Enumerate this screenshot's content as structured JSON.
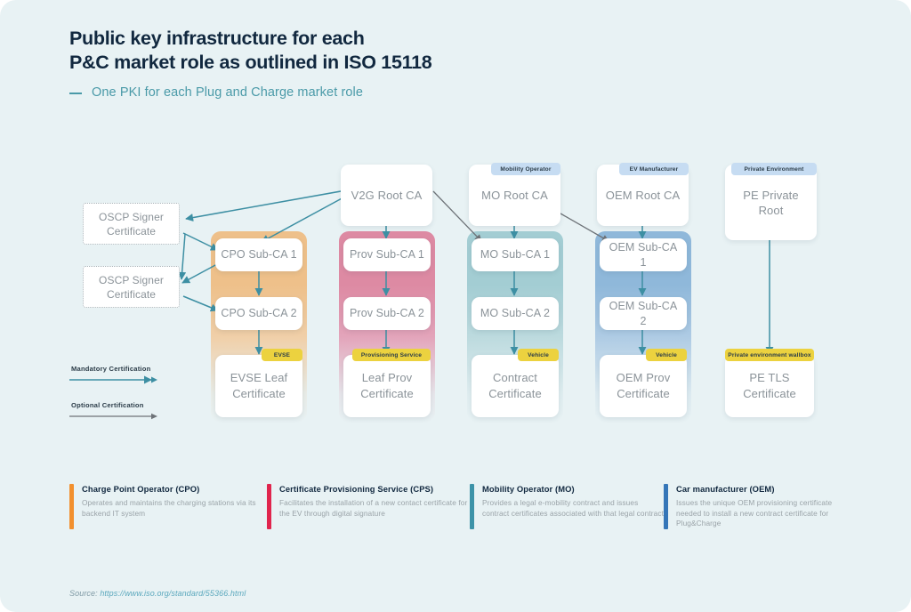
{
  "header": {
    "title_line1": "Public key infrastructure for each",
    "title_line2": "P&C market role as outlined in ISO 15118",
    "subtitle": "One PKI for each Plug and Charge market role"
  },
  "diagram": {
    "roots": [
      {
        "id": "v2g",
        "label": "V2G Root CA",
        "tag": null
      },
      {
        "id": "mo",
        "label": "MO Root CA",
        "tag": "Mobility Operator"
      },
      {
        "id": "oem",
        "label": "OEM Root CA",
        "tag": "EV Manufacturer"
      },
      {
        "id": "pe",
        "label": "PE Private\nRoot",
        "tag": "Private Environment"
      }
    ],
    "root_labels": {
      "v2g": "V2G Root CA",
      "mo": "MO Root CA",
      "oem": "OEM Root CA",
      "pe": "PE Private Root"
    },
    "root_tags": {
      "mo": "Mobility Operator",
      "oem": "EV Manufacturer",
      "pe": "Private Environment"
    },
    "ocsp": {
      "first": "OSCP Signer Certificate",
      "second": "OSCP Signer Certificate"
    },
    "columns": [
      {
        "id": "cpo",
        "color": "#eec08a",
        "sub1": "CPO Sub-CA 1",
        "sub2": "CPO Sub-CA 2",
        "leaf": "EVSE Leaf Certificate",
        "leaf_tag": "EVSE"
      },
      {
        "id": "prov",
        "color": "#dd8aa3",
        "sub1": "Prov Sub-CA 1",
        "sub2": "Prov Sub-CA 2",
        "leaf": "Leaf Prov Certificate",
        "leaf_tag": "Provisioning Service"
      },
      {
        "id": "mo",
        "color": "#a3cdd3",
        "sub1": "MO Sub-CA 1",
        "sub2": "MO Sub-CA 2",
        "leaf": "Contract Certificate",
        "leaf_tag": "Vehicle"
      },
      {
        "id": "oem",
        "color": "#8fb8da",
        "sub1": "OEM Sub-CA 1",
        "sub2": "OEM Sub-CA 2",
        "leaf": "OEM Prov Certificate",
        "leaf_tag": "Vehicle"
      },
      {
        "id": "pe",
        "color": "none",
        "sub1": null,
        "sub2": null,
        "leaf": "PE TLS Certificate",
        "leaf_tag": "Private environment wallbox"
      }
    ],
    "arrow_legend": {
      "mandatory": "Mandatory Certification",
      "optional": "Optional Certification",
      "mandatory_color": "#3d8fa3",
      "optional_color": "#6e7378"
    }
  },
  "legend": [
    {
      "title": "Charge Point Operator (CPO)",
      "desc": "Operates and maintains the charging stations via its backend IT system",
      "color": "#f2902e"
    },
    {
      "title": "Certificate Provisioning Service (CPS)",
      "desc": "Facilitates the installation of a new contact certificate for the EV through digital signature",
      "color": "#e0254d"
    },
    {
      "title": "Mobility Operator (MO)",
      "desc": "Provides a legal e-mobility contract and issues contract certificates associated with that legal contract",
      "color": "#3d93a8"
    },
    {
      "title": "Car manufacturer (OEM)",
      "desc": "Issues the unique OEM provisioning certificate needed to install a new contract certificate for Plug&Charge",
      "color": "#3576b8"
    }
  ],
  "footer": {
    "source_prefix": "Source: ",
    "source_url": "https://www.iso.org/standard/55366.html"
  }
}
